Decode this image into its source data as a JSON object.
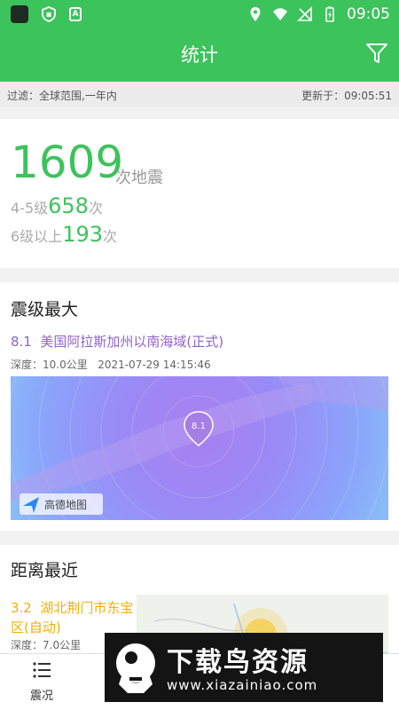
{
  "status": {
    "time": "09:05",
    "mini_label": "A"
  },
  "appbar": {
    "title": "统计",
    "filter_icon": "filter-icon"
  },
  "filter": {
    "scope": "过滤：全球范围,一年内",
    "updated": "更新于：09:05:51"
  },
  "summary": {
    "total": "1609",
    "total_unit": "次地震",
    "mid_label": "4-5级",
    "mid_count": "658",
    "mid_unit": "次",
    "high_label": "6级以上",
    "high_count": "193",
    "high_unit": "次"
  },
  "largest": {
    "title": "震级最大",
    "magnitude": "8.1",
    "place": "美国阿拉斯加州以南海域(正式)",
    "depth": "深度：10.0公里",
    "datetime": "2021-07-29 14:15:46",
    "marker": "8.1",
    "map_brand": "高德地图"
  },
  "nearest": {
    "title": "距离最近",
    "magnitude": "3.2",
    "place": "湖北荆门市东宝区(自动)",
    "depth": "深度：7.0公里"
  },
  "tabs": [
    {
      "label": "震况",
      "icon": "list-icon"
    }
  ],
  "watermark": {
    "text": "下载鸟资源",
    "url": "www.xiazainiao.com"
  },
  "colors": {
    "primary": "#3cc35c",
    "largest": "#8e63c7",
    "nearest": "#f2b000"
  }
}
